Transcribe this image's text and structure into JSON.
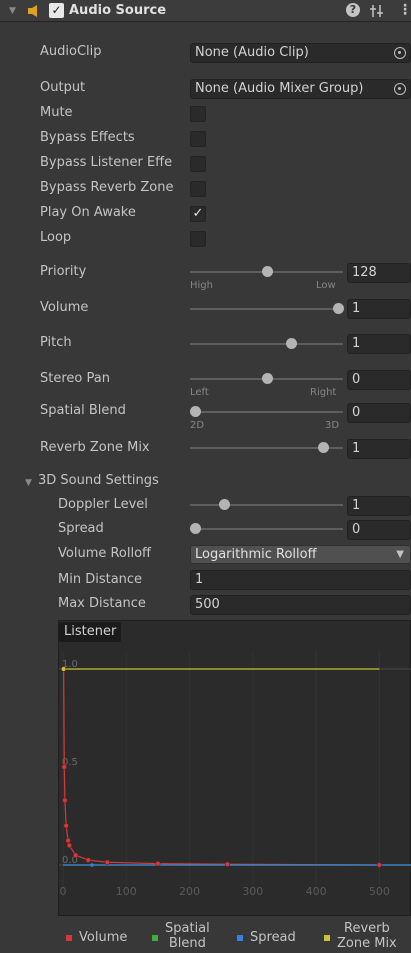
{
  "component": {
    "title": "Audio Source",
    "enabled_check": "✓"
  },
  "header_icons": {
    "help": "help-icon",
    "presets": "presets-icon",
    "menu": "more-icon"
  },
  "fields": {
    "audio_clip": {
      "label": "AudioClip",
      "value": "None (Audio Clip)"
    },
    "output": {
      "label": "Output",
      "value": "None (Audio Mixer Group)"
    }
  },
  "toggles": [
    {
      "label": "Mute",
      "checked": false
    },
    {
      "label": "Bypass Effects",
      "checked": false
    },
    {
      "label": "Bypass Listener Effe",
      "checked": false
    },
    {
      "label": "Bypass Reverb Zone",
      "checked": false
    },
    {
      "label": "Play On Awake",
      "checked": true
    },
    {
      "label": "Loop",
      "checked": false
    }
  ],
  "check_mark": "✓",
  "sliders": {
    "priority": {
      "label": "Priority",
      "value": "128",
      "fraction": 0.5,
      "min_label": "High",
      "max_label": "Low"
    },
    "volume": {
      "label": "Volume",
      "value": "1",
      "fraction": 1.0
    },
    "pitch": {
      "label": "Pitch",
      "value": "1",
      "fraction": 0.66
    },
    "stereo_pan": {
      "label": "Stereo Pan",
      "value": "0",
      "fraction": 0.5,
      "min_label": "Left",
      "max_label": "Right"
    },
    "spatial_blend": {
      "label": "Spatial Blend",
      "value": "0",
      "fraction": 0.0,
      "min_label": "2D",
      "max_label": "3D"
    },
    "reverb_zone_mix": {
      "label": "Reverb Zone Mix",
      "value": "1",
      "fraction": 0.9
    }
  },
  "sound3d": {
    "section_label": "3D Sound Settings",
    "doppler": {
      "label": "Doppler Level",
      "value": "1",
      "fraction": 0.2
    },
    "spread": {
      "label": "Spread",
      "value": "0",
      "fraction": 0.0
    },
    "volume_rolloff": {
      "label": "Volume Rolloff",
      "value": "Logarithmic Rolloff"
    },
    "min_distance": {
      "label": "Min Distance",
      "value": "1"
    },
    "max_distance": {
      "label": "Max Distance",
      "value": "500"
    }
  },
  "graph": {
    "tab_label": "Listener",
    "y_ticks": [
      "1.0",
      "0.5",
      "0.0"
    ],
    "x_ticks": [
      "0",
      "100",
      "200",
      "300",
      "400",
      "500"
    ]
  },
  "chart_data": {
    "type": "line",
    "xlim": [
      0,
      550
    ],
    "ylim": [
      0,
      1
    ],
    "series": [
      {
        "name": "Volume",
        "color": "#d23b3b",
        "x": [
          1,
          2,
          3,
          5,
          8,
          10,
          20,
          40,
          70,
          150,
          260,
          500
        ],
        "y": [
          1.0,
          0.5,
          0.33,
          0.2,
          0.125,
          0.1,
          0.05,
          0.025,
          0.014,
          0.007,
          0.004,
          0.0
        ]
      },
      {
        "name": "Spatial Blend",
        "color": "#3fae3f",
        "x": [
          0,
          550
        ],
        "y": [
          0,
          0
        ]
      },
      {
        "name": "Spread",
        "color": "#3a7ee0",
        "x": [
          0,
          550
        ],
        "y": [
          0,
          0
        ]
      },
      {
        "name": "Reverb Zone Mix",
        "color": "#c9c232",
        "x": [
          1,
          500
        ],
        "y": [
          1,
          1
        ]
      }
    ]
  },
  "legend": [
    {
      "label": "Volume",
      "color": "#d23b3b"
    },
    {
      "label": "Spatial\nBlend",
      "color": "#3fae3f"
    },
    {
      "label": "Spread",
      "color": "#3a7ee0"
    },
    {
      "label": "Reverb\nZone Mix",
      "color": "#c9c232"
    }
  ]
}
